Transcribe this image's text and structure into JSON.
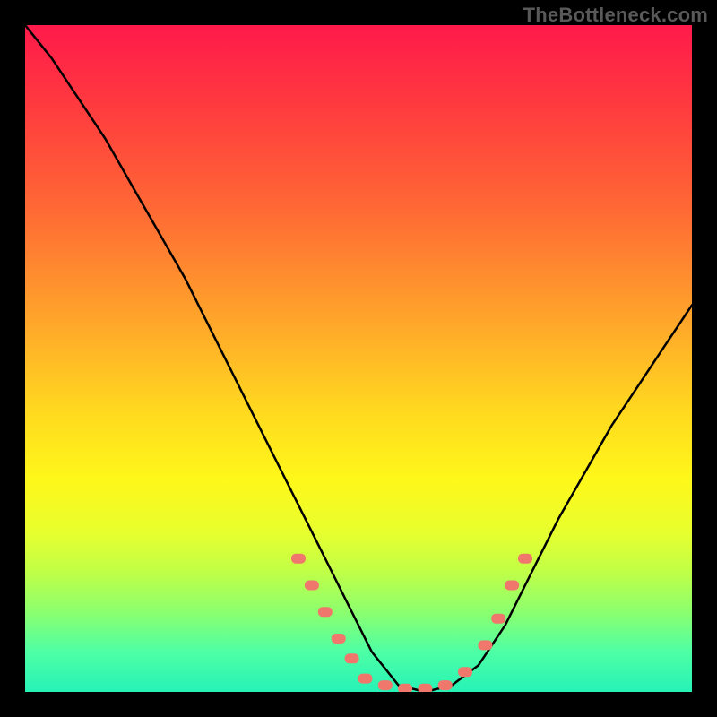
{
  "watermark": "TheBottleneck.com",
  "chart_data": {
    "type": "line",
    "title": "",
    "xlabel": "",
    "ylabel": "",
    "xlim": [
      0,
      100
    ],
    "ylim": [
      0,
      100
    ],
    "grid": false,
    "legend": false,
    "series": [
      {
        "name": "bottleneck-curve",
        "color": "#000000",
        "x": [
          0,
          4,
          8,
          12,
          16,
          20,
          24,
          28,
          32,
          36,
          40,
          44,
          48,
          52,
          56,
          60,
          64,
          68,
          72,
          76,
          80,
          84,
          88,
          92,
          96,
          100
        ],
        "y": [
          100,
          95,
          89,
          83,
          76,
          69,
          62,
          54,
          46,
          38,
          30,
          22,
          14,
          6,
          1,
          0,
          1,
          4,
          10,
          18,
          26,
          33,
          40,
          46,
          52,
          58
        ]
      }
    ],
    "markers": {
      "name": "highlighted-points",
      "color": "#f0776b",
      "points": [
        {
          "x": 41,
          "y": 20
        },
        {
          "x": 43,
          "y": 16
        },
        {
          "x": 45,
          "y": 12
        },
        {
          "x": 47,
          "y": 8
        },
        {
          "x": 49,
          "y": 5
        },
        {
          "x": 51,
          "y": 2
        },
        {
          "x": 54,
          "y": 1
        },
        {
          "x": 57,
          "y": 0.5
        },
        {
          "x": 60,
          "y": 0.5
        },
        {
          "x": 63,
          "y": 1
        },
        {
          "x": 66,
          "y": 3
        },
        {
          "x": 69,
          "y": 7
        },
        {
          "x": 71,
          "y": 11
        },
        {
          "x": 73,
          "y": 16
        },
        {
          "x": 75,
          "y": 20
        }
      ]
    },
    "background_gradient": {
      "top": "#ff1a4b",
      "mid": "#ffd91f",
      "bottom": "#26f2b7"
    }
  }
}
